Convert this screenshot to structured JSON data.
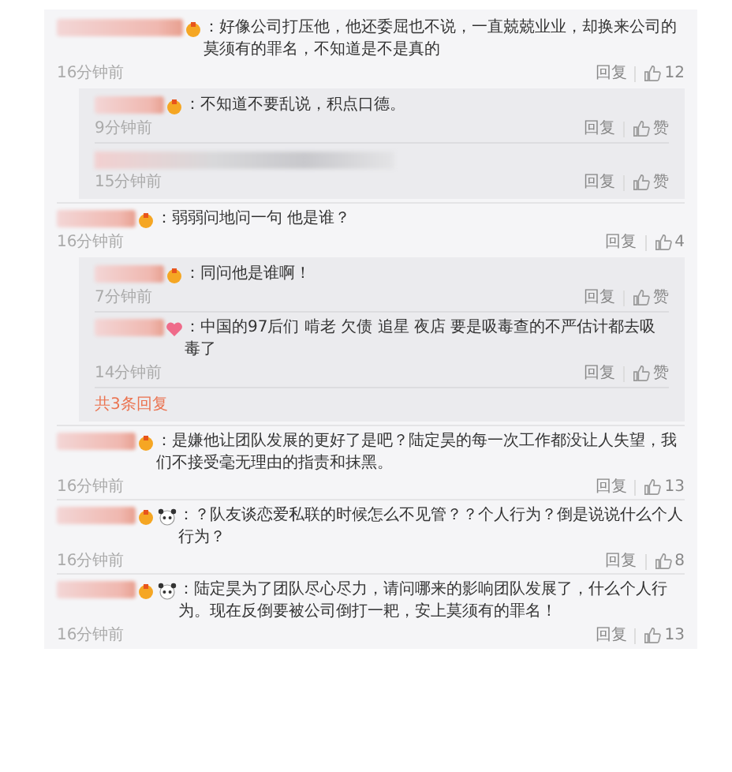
{
  "comments": [
    {
      "badges": [
        {
          "kind": "medal"
        }
      ],
      "text": "：好像公司打压他，他还委屈也不说，一直兢兢业业，却换来公司的莫须有的罪名，不知道是不是真的",
      "time": "16分钟前",
      "reply": "回复",
      "likes": "12",
      "replies": [
        {
          "kind": "text",
          "badges": [
            {
              "kind": "medal"
            }
          ],
          "text": "：不知道不要乱说，积点口德。",
          "time": "9分钟前",
          "reply": "回复",
          "likes": "赞"
        },
        {
          "kind": "blurred",
          "time": "15分钟前",
          "reply": "回复",
          "likes": "赞"
        }
      ]
    },
    {
      "badges": [
        {
          "kind": "medal"
        }
      ],
      "text": "：弱弱问地问一句 他是谁？",
      "time": "16分钟前",
      "reply": "回复",
      "likes": "4",
      "replies": [
        {
          "kind": "text",
          "badges": [
            {
              "kind": "medal"
            }
          ],
          "text": "：同问他是谁啊！",
          "time": "7分钟前",
          "reply": "回复",
          "likes": "赞"
        },
        {
          "kind": "text",
          "badges": [
            {
              "kind": "heart"
            }
          ],
          "text": "：中国的97后们 啃老 欠债  追星   夜店  要是吸毒查的不严估计都去吸毒了",
          "time": "14分钟前",
          "reply": "回复",
          "likes": "赞"
        }
      ],
      "more": "共3条回复"
    },
    {
      "badges": [
        {
          "kind": "medal"
        }
      ],
      "text": "：是嫌他让团队发展的更好了是吧？陆定昊的每一次工作都没让人失望，我们不接受毫无理由的指责和抹黑。",
      "time": "16分钟前",
      "reply": "回复",
      "likes": "13"
    },
    {
      "badges": [
        {
          "kind": "medal"
        },
        {
          "kind": "panda"
        }
      ],
      "text": "：？队友谈恋爱私联的时候怎么不见管？？个人行为？倒是说说什么个人行为？",
      "time": "16分钟前",
      "reply": "回复",
      "likes": "8"
    },
    {
      "badges": [
        {
          "kind": "medal"
        },
        {
          "kind": "panda"
        }
      ],
      "text": "：陆定昊为了团队尽心尽力，请问哪来的影响团队发展了，什么个人行为。现在反倒要被公司倒打一耙，安上莫须有的罪名！",
      "time": "16分钟前",
      "reply": "回复",
      "likes": "13"
    }
  ]
}
